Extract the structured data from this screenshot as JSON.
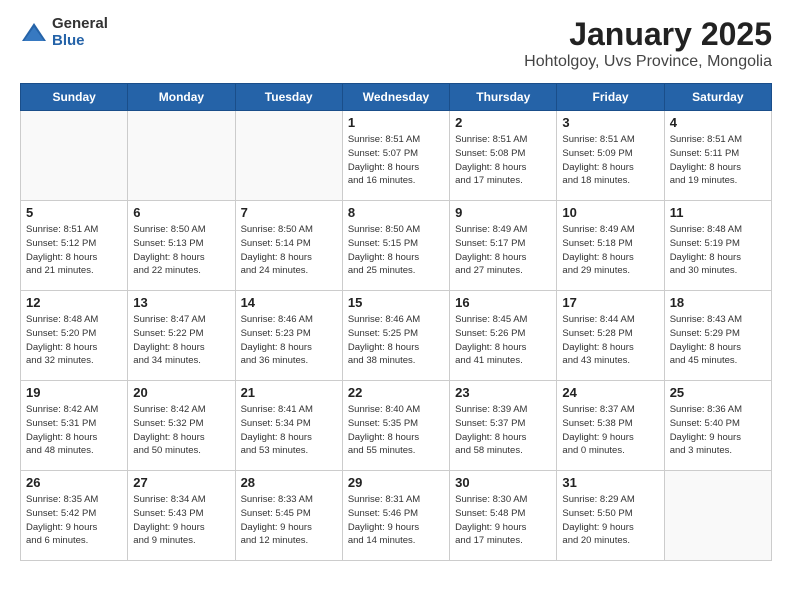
{
  "header": {
    "logo": {
      "line1": "General",
      "line2": "Blue"
    },
    "title": "January 2025",
    "location": "Hohtolgoy, Uvs Province, Mongolia"
  },
  "days_of_week": [
    "Sunday",
    "Monday",
    "Tuesday",
    "Wednesday",
    "Thursday",
    "Friday",
    "Saturday"
  ],
  "weeks": [
    [
      {
        "day": "",
        "info": ""
      },
      {
        "day": "",
        "info": ""
      },
      {
        "day": "",
        "info": ""
      },
      {
        "day": "1",
        "info": "Sunrise: 8:51 AM\nSunset: 5:07 PM\nDaylight: 8 hours\nand 16 minutes."
      },
      {
        "day": "2",
        "info": "Sunrise: 8:51 AM\nSunset: 5:08 PM\nDaylight: 8 hours\nand 17 minutes."
      },
      {
        "day": "3",
        "info": "Sunrise: 8:51 AM\nSunset: 5:09 PM\nDaylight: 8 hours\nand 18 minutes."
      },
      {
        "day": "4",
        "info": "Sunrise: 8:51 AM\nSunset: 5:11 PM\nDaylight: 8 hours\nand 19 minutes."
      }
    ],
    [
      {
        "day": "5",
        "info": "Sunrise: 8:51 AM\nSunset: 5:12 PM\nDaylight: 8 hours\nand 21 minutes."
      },
      {
        "day": "6",
        "info": "Sunrise: 8:50 AM\nSunset: 5:13 PM\nDaylight: 8 hours\nand 22 minutes."
      },
      {
        "day": "7",
        "info": "Sunrise: 8:50 AM\nSunset: 5:14 PM\nDaylight: 8 hours\nand 24 minutes."
      },
      {
        "day": "8",
        "info": "Sunrise: 8:50 AM\nSunset: 5:15 PM\nDaylight: 8 hours\nand 25 minutes."
      },
      {
        "day": "9",
        "info": "Sunrise: 8:49 AM\nSunset: 5:17 PM\nDaylight: 8 hours\nand 27 minutes."
      },
      {
        "day": "10",
        "info": "Sunrise: 8:49 AM\nSunset: 5:18 PM\nDaylight: 8 hours\nand 29 minutes."
      },
      {
        "day": "11",
        "info": "Sunrise: 8:48 AM\nSunset: 5:19 PM\nDaylight: 8 hours\nand 30 minutes."
      }
    ],
    [
      {
        "day": "12",
        "info": "Sunrise: 8:48 AM\nSunset: 5:20 PM\nDaylight: 8 hours\nand 32 minutes."
      },
      {
        "day": "13",
        "info": "Sunrise: 8:47 AM\nSunset: 5:22 PM\nDaylight: 8 hours\nand 34 minutes."
      },
      {
        "day": "14",
        "info": "Sunrise: 8:46 AM\nSunset: 5:23 PM\nDaylight: 8 hours\nand 36 minutes."
      },
      {
        "day": "15",
        "info": "Sunrise: 8:46 AM\nSunset: 5:25 PM\nDaylight: 8 hours\nand 38 minutes."
      },
      {
        "day": "16",
        "info": "Sunrise: 8:45 AM\nSunset: 5:26 PM\nDaylight: 8 hours\nand 41 minutes."
      },
      {
        "day": "17",
        "info": "Sunrise: 8:44 AM\nSunset: 5:28 PM\nDaylight: 8 hours\nand 43 minutes."
      },
      {
        "day": "18",
        "info": "Sunrise: 8:43 AM\nSunset: 5:29 PM\nDaylight: 8 hours\nand 45 minutes."
      }
    ],
    [
      {
        "day": "19",
        "info": "Sunrise: 8:42 AM\nSunset: 5:31 PM\nDaylight: 8 hours\nand 48 minutes."
      },
      {
        "day": "20",
        "info": "Sunrise: 8:42 AM\nSunset: 5:32 PM\nDaylight: 8 hours\nand 50 minutes."
      },
      {
        "day": "21",
        "info": "Sunrise: 8:41 AM\nSunset: 5:34 PM\nDaylight: 8 hours\nand 53 minutes."
      },
      {
        "day": "22",
        "info": "Sunrise: 8:40 AM\nSunset: 5:35 PM\nDaylight: 8 hours\nand 55 minutes."
      },
      {
        "day": "23",
        "info": "Sunrise: 8:39 AM\nSunset: 5:37 PM\nDaylight: 8 hours\nand 58 minutes."
      },
      {
        "day": "24",
        "info": "Sunrise: 8:37 AM\nSunset: 5:38 PM\nDaylight: 9 hours\nand 0 minutes."
      },
      {
        "day": "25",
        "info": "Sunrise: 8:36 AM\nSunset: 5:40 PM\nDaylight: 9 hours\nand 3 minutes."
      }
    ],
    [
      {
        "day": "26",
        "info": "Sunrise: 8:35 AM\nSunset: 5:42 PM\nDaylight: 9 hours\nand 6 minutes."
      },
      {
        "day": "27",
        "info": "Sunrise: 8:34 AM\nSunset: 5:43 PM\nDaylight: 9 hours\nand 9 minutes."
      },
      {
        "day": "28",
        "info": "Sunrise: 8:33 AM\nSunset: 5:45 PM\nDaylight: 9 hours\nand 12 minutes."
      },
      {
        "day": "29",
        "info": "Sunrise: 8:31 AM\nSunset: 5:46 PM\nDaylight: 9 hours\nand 14 minutes."
      },
      {
        "day": "30",
        "info": "Sunrise: 8:30 AM\nSunset: 5:48 PM\nDaylight: 9 hours\nand 17 minutes."
      },
      {
        "day": "31",
        "info": "Sunrise: 8:29 AM\nSunset: 5:50 PM\nDaylight: 9 hours\nand 20 minutes."
      },
      {
        "day": "",
        "info": ""
      }
    ]
  ]
}
